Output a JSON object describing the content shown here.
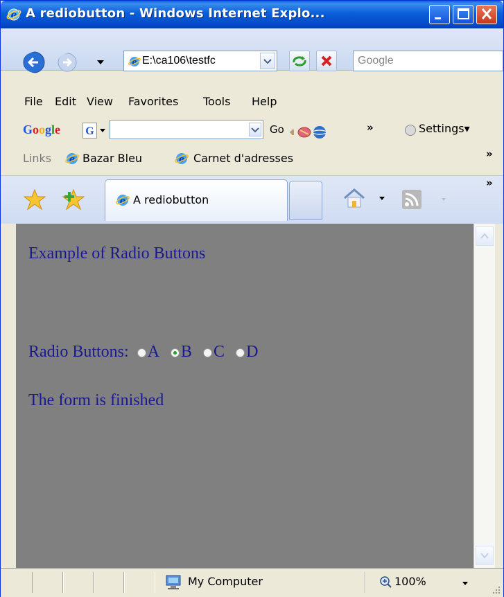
{
  "window": {
    "title": "A rediobutton - Windows Internet Explo..."
  },
  "address_bar": {
    "url": "E:\\ca106\\testfc",
    "search_placeholder": "Google"
  },
  "menu": [
    "File",
    "Edit",
    "View",
    "Favorites",
    "Tools",
    "Help"
  ],
  "google_toolbar": {
    "logo": "Google",
    "go_label": "Go",
    "settings_label": "Settings▾",
    "more_chevron": "»"
  },
  "links_bar": {
    "label": "Links",
    "items": [
      "Bazar Bleu",
      "Carnet d'adresses"
    ],
    "more_chevron": "»"
  },
  "tabs": {
    "active_title": "A rediobutton",
    "more_chevron": "»"
  },
  "page": {
    "heading": "Example of Radio Buttons",
    "radio_group_label": "Radio Buttons:",
    "radio_options": [
      "A",
      "B",
      "C",
      "D"
    ],
    "selected_option": "B",
    "footer_text": "The form is finished",
    "background_color": "#808080",
    "text_color": "#1a1a8c"
  },
  "status_bar": {
    "zone": "My Computer",
    "zoom": "100%"
  }
}
